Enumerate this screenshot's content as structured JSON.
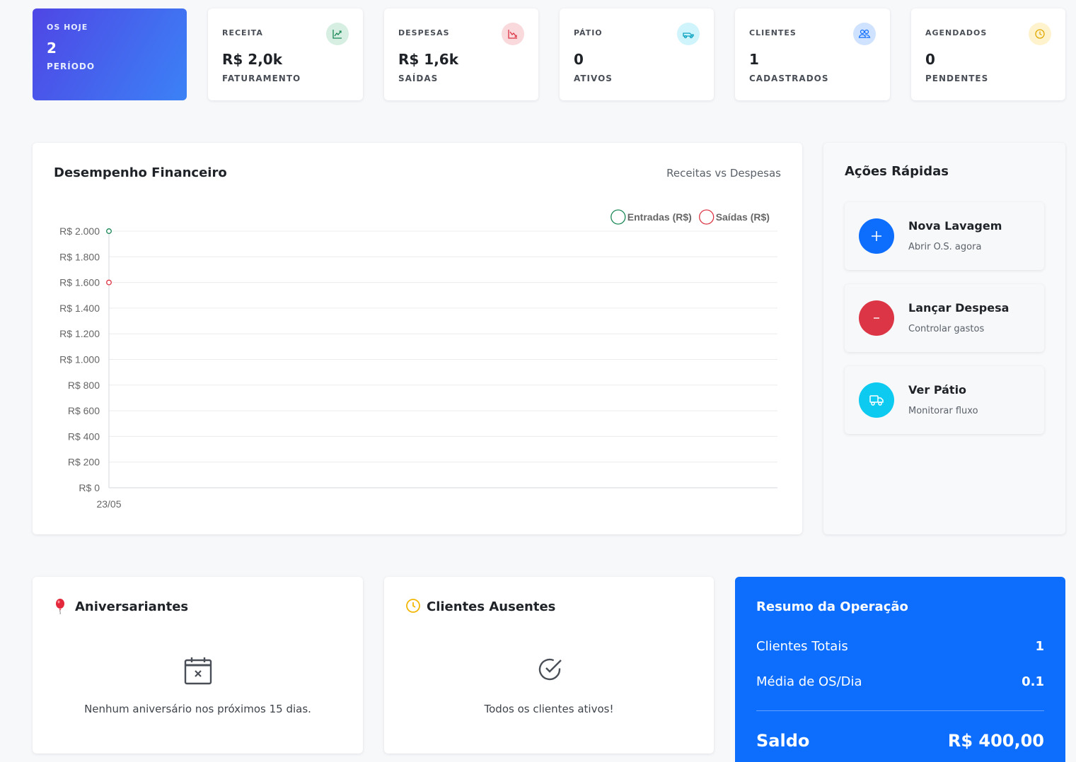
{
  "stats": [
    {
      "label": "OS HOJE",
      "value": "2",
      "sub": "PERÍODO",
      "icon": "",
      "accent": "#4f46e5"
    },
    {
      "label": "RECEITA",
      "value": "R$ 2,0k",
      "sub": "FATURAMENTO",
      "icon": "trend-up-icon",
      "accent": "#198754",
      "icon_bg": "#d7efe3"
    },
    {
      "label": "DESPESAS",
      "value": "R$ 1,6k",
      "sub": "SAÍDAS",
      "icon": "trend-down-icon",
      "accent": "#dc3545",
      "icon_bg": "#f9d9dc"
    },
    {
      "label": "PÁTIO",
      "value": "0",
      "sub": "ATIVOS",
      "icon": "car-icon",
      "accent": "#0dcaf0",
      "icon_bg": "#cff4fc"
    },
    {
      "label": "CLIENTES",
      "value": "1",
      "sub": "CADASTRADOS",
      "icon": "users-icon",
      "accent": "#0d6efd",
      "icon_bg": "#cfe2ff"
    },
    {
      "label": "AGENDADOS",
      "value": "0",
      "sub": "PENDENTES",
      "icon": "clock-icon",
      "accent": "#ffc107",
      "icon_bg": "#fff3cd"
    }
  ],
  "chart_panel": {
    "title": "Desempenho Financeiro",
    "subtitle": "Receitas vs Despesas"
  },
  "chart_data": {
    "type": "line",
    "categories": [
      "23/05"
    ],
    "series": [
      {
        "name": "Entradas (R$)",
        "values": [
          2000
        ],
        "color": "#198754"
      },
      {
        "name": "Saídas (R$)",
        "values": [
          1600
        ],
        "color": "#dc3545"
      }
    ],
    "ylim": [
      0,
      2000
    ],
    "yticks": [
      "R$ 0",
      "R$ 200",
      "R$ 400",
      "R$ 600",
      "R$ 800",
      "R$ 1.000",
      "R$ 1.200",
      "R$ 1.400",
      "R$ 1.600",
      "R$ 1.800",
      "R$ 2.000"
    ],
    "grid": true,
    "legend": "top-right",
    "title": "",
    "xlabel": "",
    "ylabel": ""
  },
  "quick_actions": {
    "title": "Ações Rápidas",
    "items": [
      {
        "title": "Nova Lavagem",
        "sub": "Abrir O.S. agora",
        "symbol": "+",
        "color": "#0d6efd"
      },
      {
        "title": "Lançar Despesa",
        "sub": "Controlar gastos",
        "symbol": "−",
        "color": "#dc3545"
      },
      {
        "title": "Ver Pátio",
        "sub": "Monitorar fluxo",
        "symbol": "",
        "color": "#0dcaf0"
      }
    ]
  },
  "birthdays": {
    "title": "Aniversariantes",
    "empty": "Nenhum aniversário nos próximos 15 dias."
  },
  "absent": {
    "title": "Clientes Ausentes",
    "empty": "Todos os clientes ativos!"
  },
  "summary": {
    "title": "Resumo da Operação",
    "rows": [
      {
        "label": "Clientes Totais",
        "value": "1"
      },
      {
        "label": "Média de OS/Dia",
        "value": "0.1"
      }
    ],
    "saldo_label": "Saldo",
    "saldo_value": "R$ 400,00",
    "bg": "#0d6efd"
  }
}
